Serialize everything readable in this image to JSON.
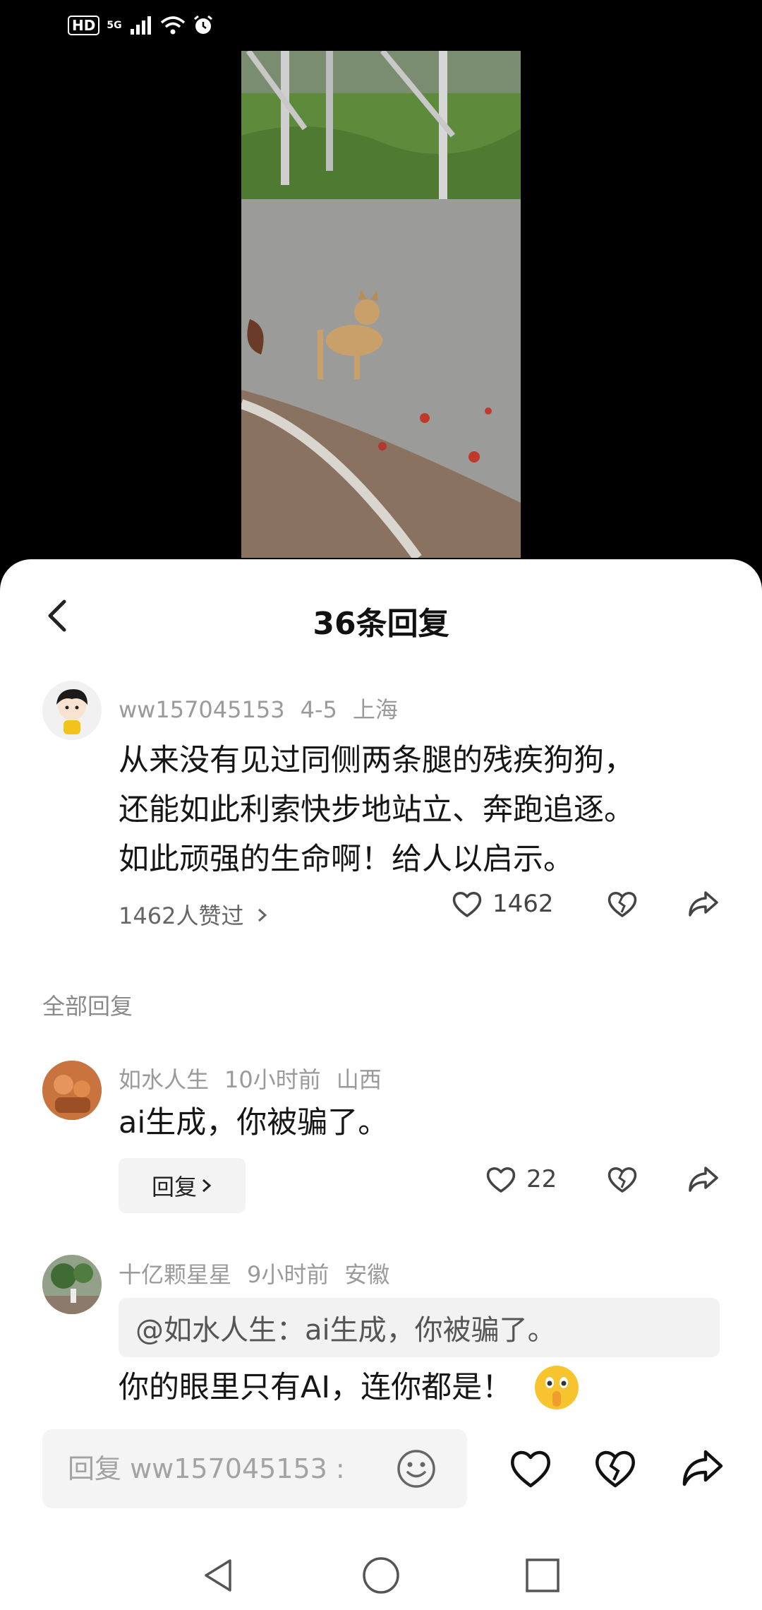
{
  "status_bar": {
    "hd": "HD",
    "network": "5G"
  },
  "sheet": {
    "title": "36条回复"
  },
  "main_comment": {
    "user": "ww157045153",
    "date": "4-5",
    "location": "上海",
    "text_lines": [
      "从来没有见过同侧两条腿的残疾狗狗，",
      "还能如此利索快步地站立、奔跑追逐。",
      "如此顽强的生命啊！给人以启示。"
    ],
    "likes_link": "1462人赞过",
    "like_count": "1462"
  },
  "section_label": "全部回复",
  "replies": [
    {
      "user": "如水人生",
      "time": "10小时前",
      "location": "山西",
      "text": "ai生成，你被骗了。",
      "reply_label": "回复",
      "like_count": "22"
    },
    {
      "user": "十亿颗星星",
      "time": "9小时前",
      "location": "安徽",
      "quote": "@如水人生：ai生成，你被骗了。",
      "text": "你的眼里只有AI，连你都是！",
      "emoji": "shushing-face-emoji"
    }
  ],
  "composer": {
    "placeholder": "回复 ww157045153 :"
  },
  "icons": {
    "like": "heart-icon",
    "dislike": "broken-heart-icon",
    "share": "share-arrow-icon",
    "emoji": "smiley-icon"
  },
  "colors": {
    "sheet_bg": "#ffffff",
    "muted_text": "#9a9a9a",
    "quote_bg": "#f2f2f2"
  }
}
